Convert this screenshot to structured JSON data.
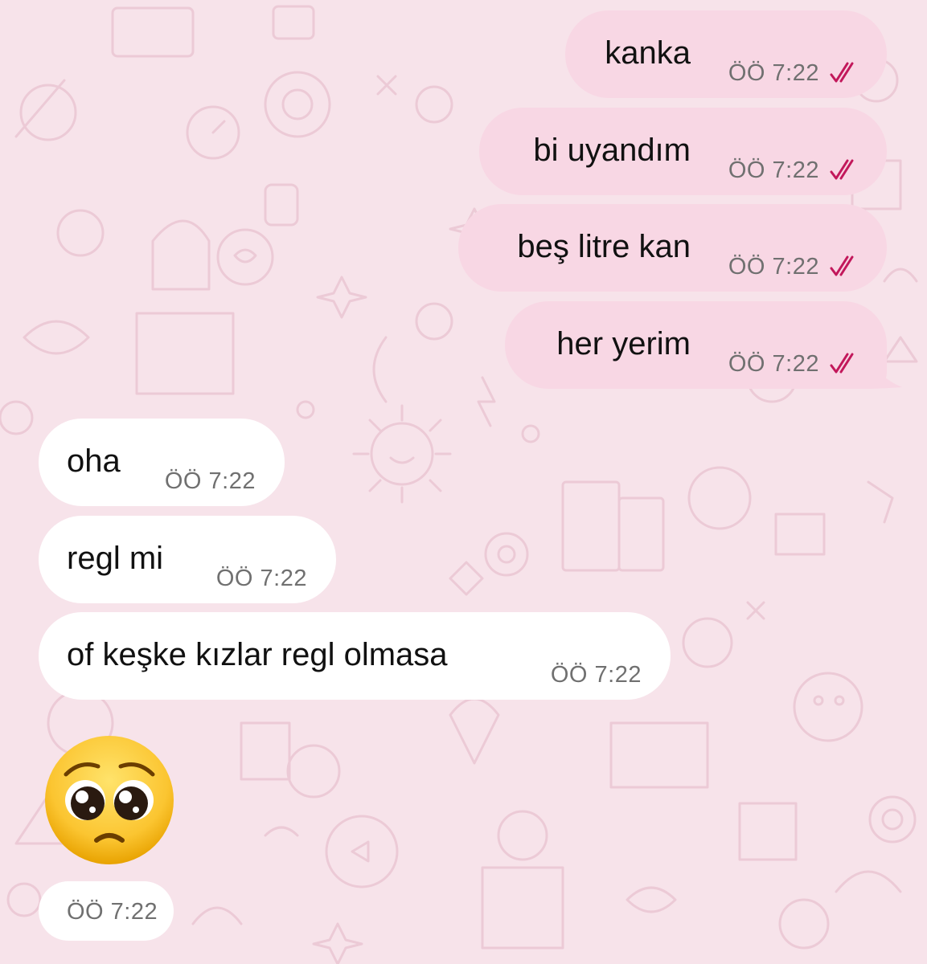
{
  "chat": {
    "outgoing": [
      {
        "text": "kanka",
        "time": "ÖÖ 7:22",
        "status": "read"
      },
      {
        "text": "bi uyandım",
        "time": "ÖÖ 7:22",
        "status": "read"
      },
      {
        "text": "beş litre kan",
        "time": "ÖÖ 7:22",
        "status": "read"
      },
      {
        "text": "her yerim",
        "time": "ÖÖ 7:22",
        "status": "read"
      }
    ],
    "incoming": [
      {
        "text": "oha",
        "time": "ÖÖ 7:22"
      },
      {
        "text": "regl mi",
        "time": "ÖÖ 7:22"
      },
      {
        "text": "of keşke kızlar regl olmasa",
        "time": "ÖÖ 7:22"
      }
    ],
    "emoji_message": {
      "emoji": "pleading-face",
      "time": "ÖÖ 7:22"
    }
  },
  "colors": {
    "background": "#f7e3ea",
    "outgoing_bubble": "#f8d7e4",
    "incoming_bubble": "#ffffff",
    "read_ticks": "#c2185b",
    "time_text": "#707070"
  }
}
